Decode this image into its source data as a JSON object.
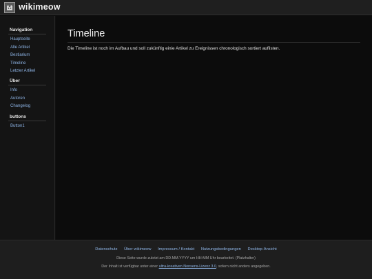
{
  "header": {
    "logo_icon": "cat-logo-icon",
    "title": "wikimeow"
  },
  "sidebar": {
    "sections": [
      {
        "heading": "Navigation",
        "items": [
          {
            "label": "Hauptseite"
          },
          {
            "label": "Alle Artikel"
          },
          {
            "label": "Bestiarium"
          },
          {
            "label": "Timeline"
          },
          {
            "label": "Letzter Artikel"
          }
        ]
      },
      {
        "heading": "Über",
        "items": [
          {
            "label": "Info"
          },
          {
            "label": "Autoren"
          },
          {
            "label": "Changelog"
          }
        ]
      },
      {
        "heading": "buttons",
        "items": [
          {
            "label": "Button1"
          }
        ]
      }
    ]
  },
  "main": {
    "title": "Timeline",
    "text": "Die Timeline ist noch im Aufbau und soll zukünftig einie Artikel zu Ereignissen chronologisch sortiert auflisten."
  },
  "footer": {
    "links": [
      {
        "label": "Datenschutz"
      },
      {
        "label": "Über wikimeow"
      },
      {
        "label": "Impressum / Kontakt"
      },
      {
        "label": "Nutzungsbedingungen"
      },
      {
        "label": "Desktop-Ansicht"
      }
    ],
    "updated_text": "Diese Seite wurde zuletzt am DD.MM.YYYY um HH:MM Uhr bearbeitet. (Platzhalter)",
    "license_prefix": "Der Inhalt ist verfügbar unter einer",
    "license_link": "ultra-kreativen Nonsens-Lizenz 3.0",
    "license_suffix": ", sofern nicht anders angegeben."
  },
  "colors": {
    "background": "#101010",
    "link": "#8fb6e8",
    "text": "#e6e6e6"
  }
}
